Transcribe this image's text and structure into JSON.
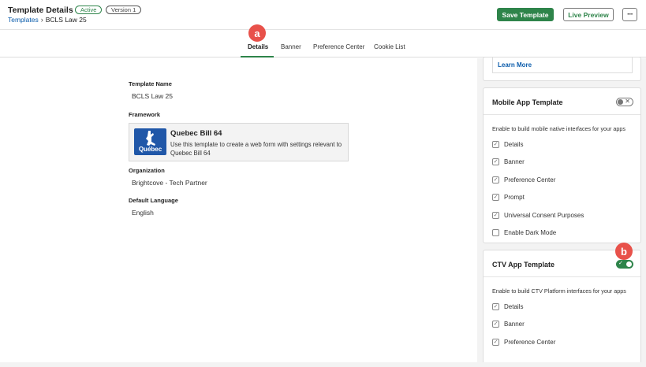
{
  "header": {
    "title": "Template Details",
    "status_badge": "Active",
    "version_badge": "Version 1",
    "breadcrumb": {
      "parent": "Templates",
      "separator": "›",
      "current": "BCLS Law 25"
    },
    "save_label": "Save Template",
    "preview_label": "Live Preview",
    "more_label": "···"
  },
  "tabs": [
    {
      "label": "Details",
      "active": true
    },
    {
      "label": "Banner"
    },
    {
      "label": "Preference Center"
    },
    {
      "label": "Cookie List"
    }
  ],
  "markers": {
    "a": "a",
    "b": "b"
  },
  "details": {
    "template_name_label": "Template Name",
    "template_name_value": "BCLS Law 25",
    "framework_label": "Framework",
    "framework": {
      "logo_text": "Québec",
      "name": "Quebec Bill 64",
      "description": "Use this template to create a web form with settings relevant to Quebec Bill 64"
    },
    "organization_label": "Organization",
    "organization_value": "Brightcove - Tech Partner",
    "language_label": "Default Language",
    "language_value": "English"
  },
  "side": {
    "learn_more": "Learn More",
    "mobile": {
      "title": "Mobile App Template",
      "enabled": false,
      "description": "Enable to build mobile native interfaces for your apps",
      "options": [
        {
          "label": "Details",
          "checked": true
        },
        {
          "label": "Banner",
          "checked": true
        },
        {
          "label": "Preference Center",
          "checked": true
        },
        {
          "label": "Prompt",
          "checked": true
        },
        {
          "label": "Universal Consent Purposes",
          "checked": true
        },
        {
          "label": "Enable Dark Mode",
          "checked": false
        }
      ]
    },
    "ctv": {
      "title": "CTV App Template",
      "enabled": true,
      "description": "Enable to build CTV Platform interfaces for your apps",
      "options": [
        {
          "label": "Details",
          "checked": true
        },
        {
          "label": "Banner",
          "checked": true
        },
        {
          "label": "Preference Center",
          "checked": true
        }
      ]
    }
  },
  "colors": {
    "accent": "#2e844a",
    "link": "#0b5cab",
    "marker": "#e8514a",
    "quebec_blue": "#2057a8"
  }
}
